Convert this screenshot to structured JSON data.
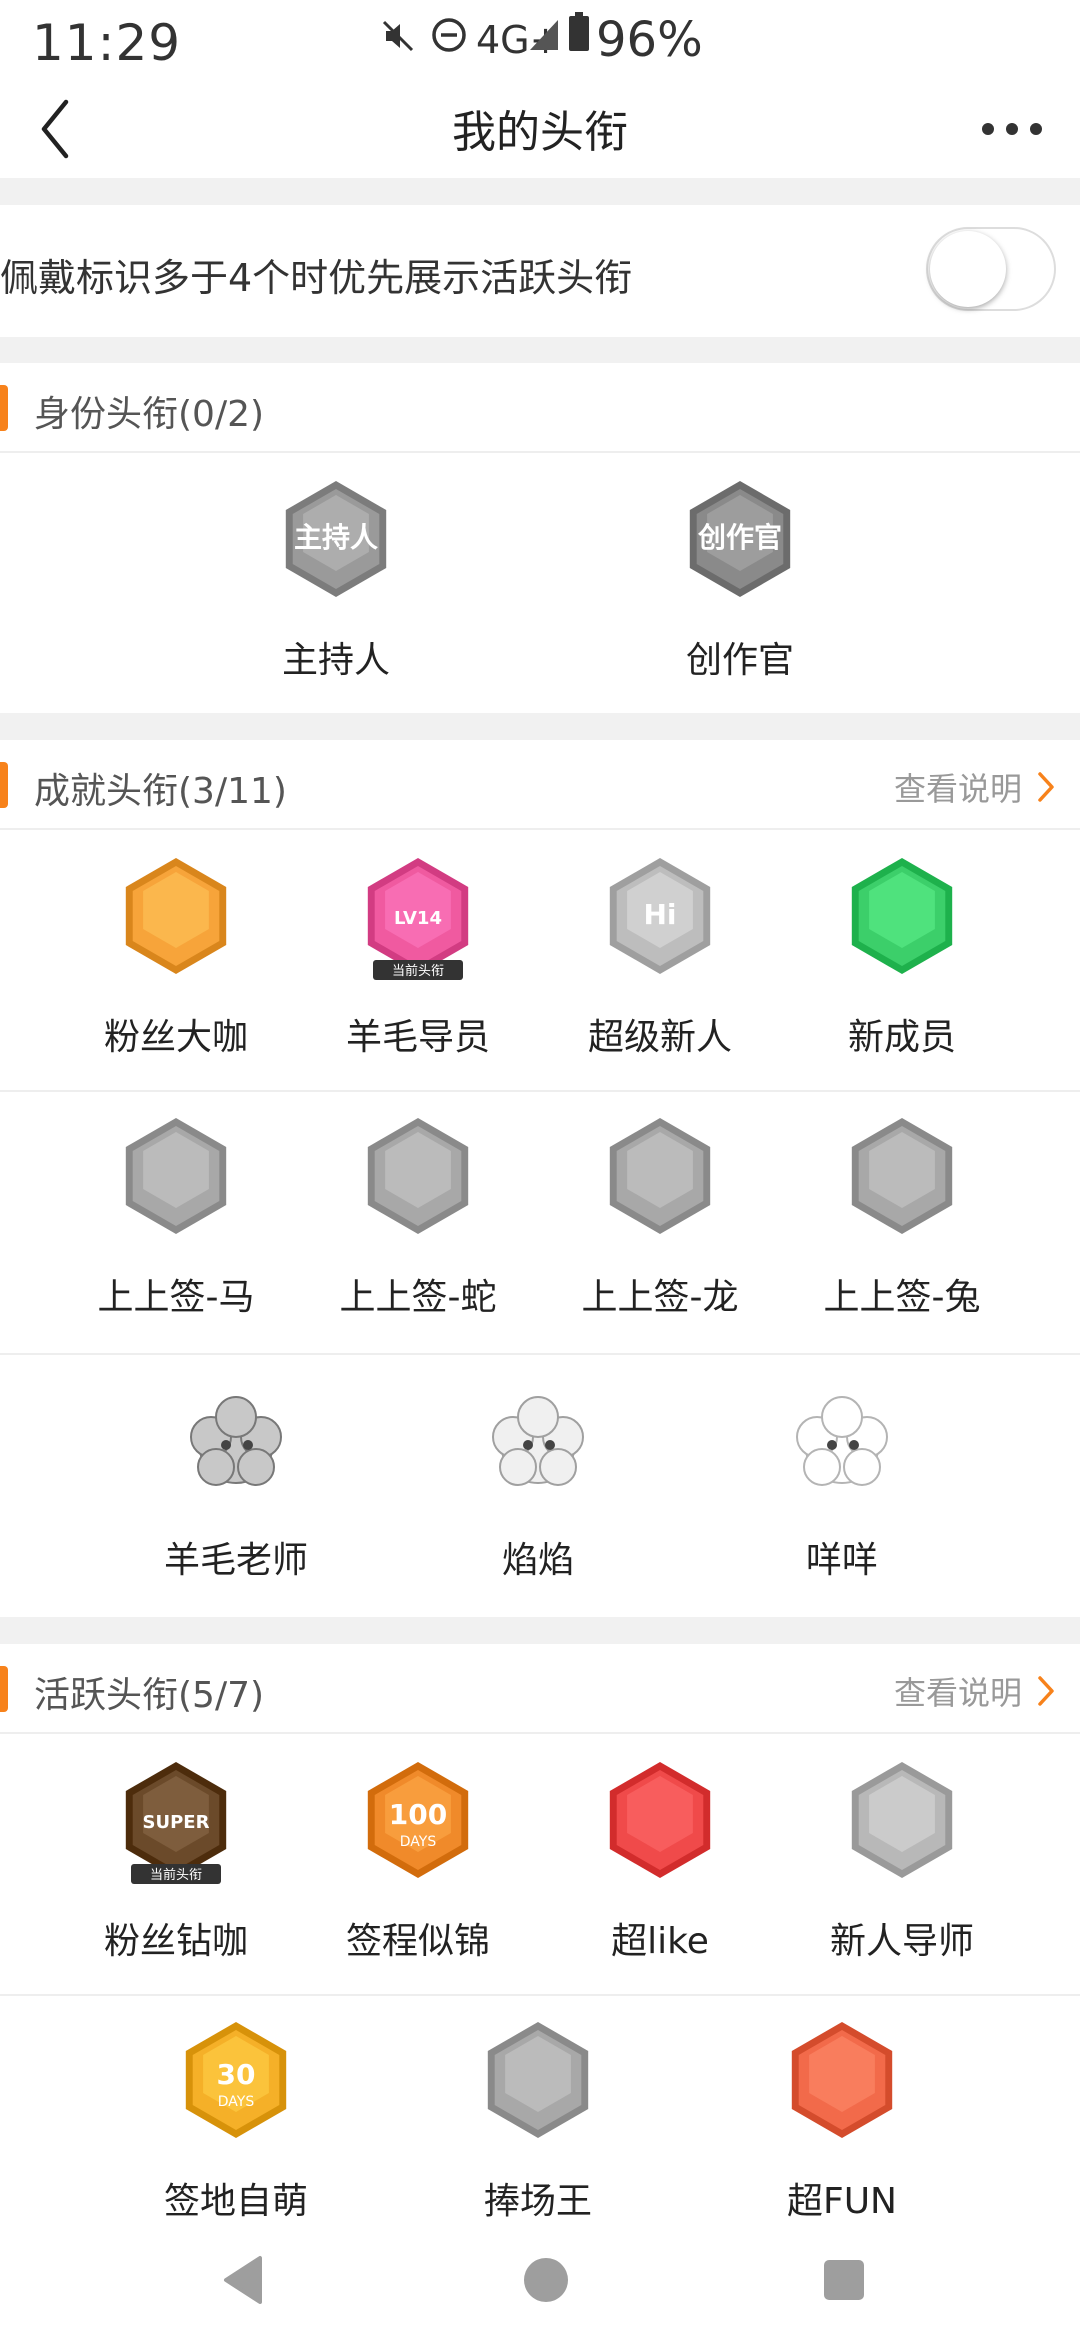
{
  "status_bar": {
    "time": "11:29",
    "network": "4G+",
    "battery": "96%",
    "icons": [
      "mute-icon",
      "dnd-icon",
      "signal-icon",
      "battery-icon"
    ]
  },
  "title_bar": {
    "title": "我的头衔"
  },
  "settings": {
    "priority_label": "佩戴标识多于4个时优先展示活跃头衔",
    "priority_enabled": false
  },
  "sections": {
    "identity": {
      "title": "身份头衔(0/2)",
      "badges": [
        {
          "label": "主持人",
          "icon": "host-microphone-icon",
          "color": "#9a9a9a",
          "inner": "主持人",
          "active": false
        },
        {
          "label": "创作官",
          "icon": "creator-hand-icon",
          "color": "#8a8a8a",
          "inner": "创作官",
          "active": false
        }
      ]
    },
    "achievement": {
      "title": "成就头衔(3/11)",
      "link": "查看说明",
      "badges": [
        {
          "label": "粉丝大咖",
          "icon": "crown-badge-icon",
          "color": "#f7a43a",
          "active": true
        },
        {
          "label": "羊毛导员",
          "icon": "level-badge-icon",
          "color": "#f05aa0",
          "inner": "LV14",
          "tag": "当前头衔",
          "active": true
        },
        {
          "label": "超级新人",
          "icon": "hi-badge-icon",
          "color": "#bdbdbd",
          "inner": "Hi",
          "active": false
        },
        {
          "label": "新成员",
          "icon": "wave-hand-badge-icon",
          "color": "#3ccf6a",
          "active": true
        },
        {
          "label": "上上签-马",
          "icon": "horse-badge-icon",
          "color": "#a8a8a8",
          "active": false
        },
        {
          "label": "上上签-蛇",
          "icon": "snake-badge-icon",
          "color": "#a8a8a8",
          "active": false
        },
        {
          "label": "上上签-龙",
          "icon": "dragon-badge-icon",
          "color": "#a8a8a8",
          "active": false
        },
        {
          "label": "上上签-兔",
          "icon": "rabbit-badge-icon",
          "color": "#a8a8a8",
          "active": false
        },
        {
          "label": "羊毛老师",
          "icon": "sheep-teacher-icon",
          "color": "#a0a0a0",
          "active": false
        },
        {
          "label": "焰焰",
          "icon": "sheep-helmet-icon",
          "color": "#c8c8c8",
          "active": false
        },
        {
          "label": "咩咩",
          "icon": "sheep-fluffy-icon",
          "color": "#dcdcdc",
          "active": false
        }
      ]
    },
    "activity": {
      "title": "活跃头衔(5/7)",
      "link": "查看说明",
      "badges": [
        {
          "label": "粉丝钻咖",
          "icon": "super-crown-badge-icon",
          "color": "#6b4a2a",
          "inner": "SUPER",
          "tag": "当前头衔",
          "active": true
        },
        {
          "label": "签程似锦",
          "icon": "days-100-badge-icon",
          "color": "#f08a2a",
          "inner": "100",
          "sub": "DAYS",
          "active": true
        },
        {
          "label": "超like",
          "icon": "trophy-badge-icon",
          "color": "#f04a4a",
          "active": true
        },
        {
          "label": "新人导师",
          "icon": "graduation-cap-badge-icon",
          "color": "#b8b8b8",
          "active": false
        },
        {
          "label": "签地自萌",
          "icon": "days-30-badge-icon",
          "color": "#f5b028",
          "inner": "30",
          "sub": "DAYS",
          "active": true
        },
        {
          "label": "捧场王",
          "icon": "cheer-face-badge-icon",
          "color": "#a8a8a8",
          "active": false
        },
        {
          "label": "超FUN",
          "icon": "rock-hand-badge-icon",
          "color": "#f26a4a",
          "active": true
        }
      ]
    }
  },
  "nav": {
    "icons": [
      "back-triangle-icon",
      "home-circle-icon",
      "recents-square-icon"
    ]
  },
  "colors": {
    "accent": "#f7821b",
    "background_gap": "#f1f1f1"
  }
}
